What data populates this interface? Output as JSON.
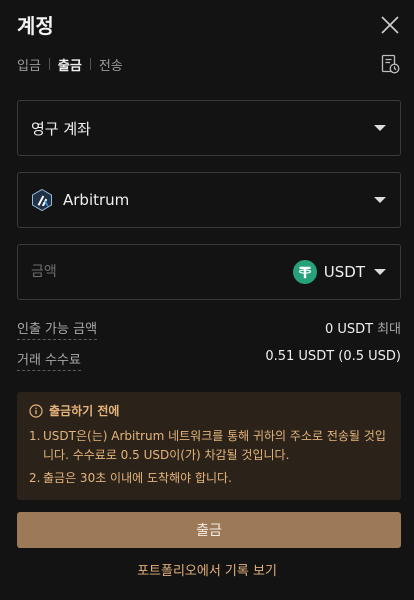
{
  "header": {
    "title": "계정"
  },
  "tabs": [
    {
      "label": "입금",
      "active": false
    },
    {
      "label": "출금",
      "active": true
    },
    {
      "label": "전송",
      "active": false
    }
  ],
  "account_select": {
    "value": "영구 계좌"
  },
  "network_select": {
    "value": "Arbitrum",
    "icon": "arbitrum-logo"
  },
  "amount": {
    "placeholder": "금액",
    "value": "",
    "currency": "USDT",
    "currency_icon": "tether-logo"
  },
  "info": {
    "available": {
      "label": "인출 가능 금액",
      "value": "0 USDT",
      "action": "최대"
    },
    "fee": {
      "label": "거래 수수료",
      "value": "0.51 USDT (0.5 USD)"
    }
  },
  "notice": {
    "title": "출금하기 전에",
    "items": [
      {
        "num": "1.",
        "text": "USDT은(는) Arbitrum 네트워크를 통해 귀하의 주소로 전송될 것입니다. 수수료로 0.5 USD이(가) 차감될 것입니다."
      },
      {
        "num": "2.",
        "text": "출금은 30초 이내에 도착해야 합니다."
      }
    ]
  },
  "submit": {
    "label": "출금"
  },
  "footer_link": {
    "label": "포트폴리오에서 기록 보기"
  },
  "colors": {
    "background": "#131313",
    "accent": "#9c7a57",
    "notice_bg": "#2b231a",
    "notice_text": "#e4b47c",
    "link": "#e2b07b"
  }
}
